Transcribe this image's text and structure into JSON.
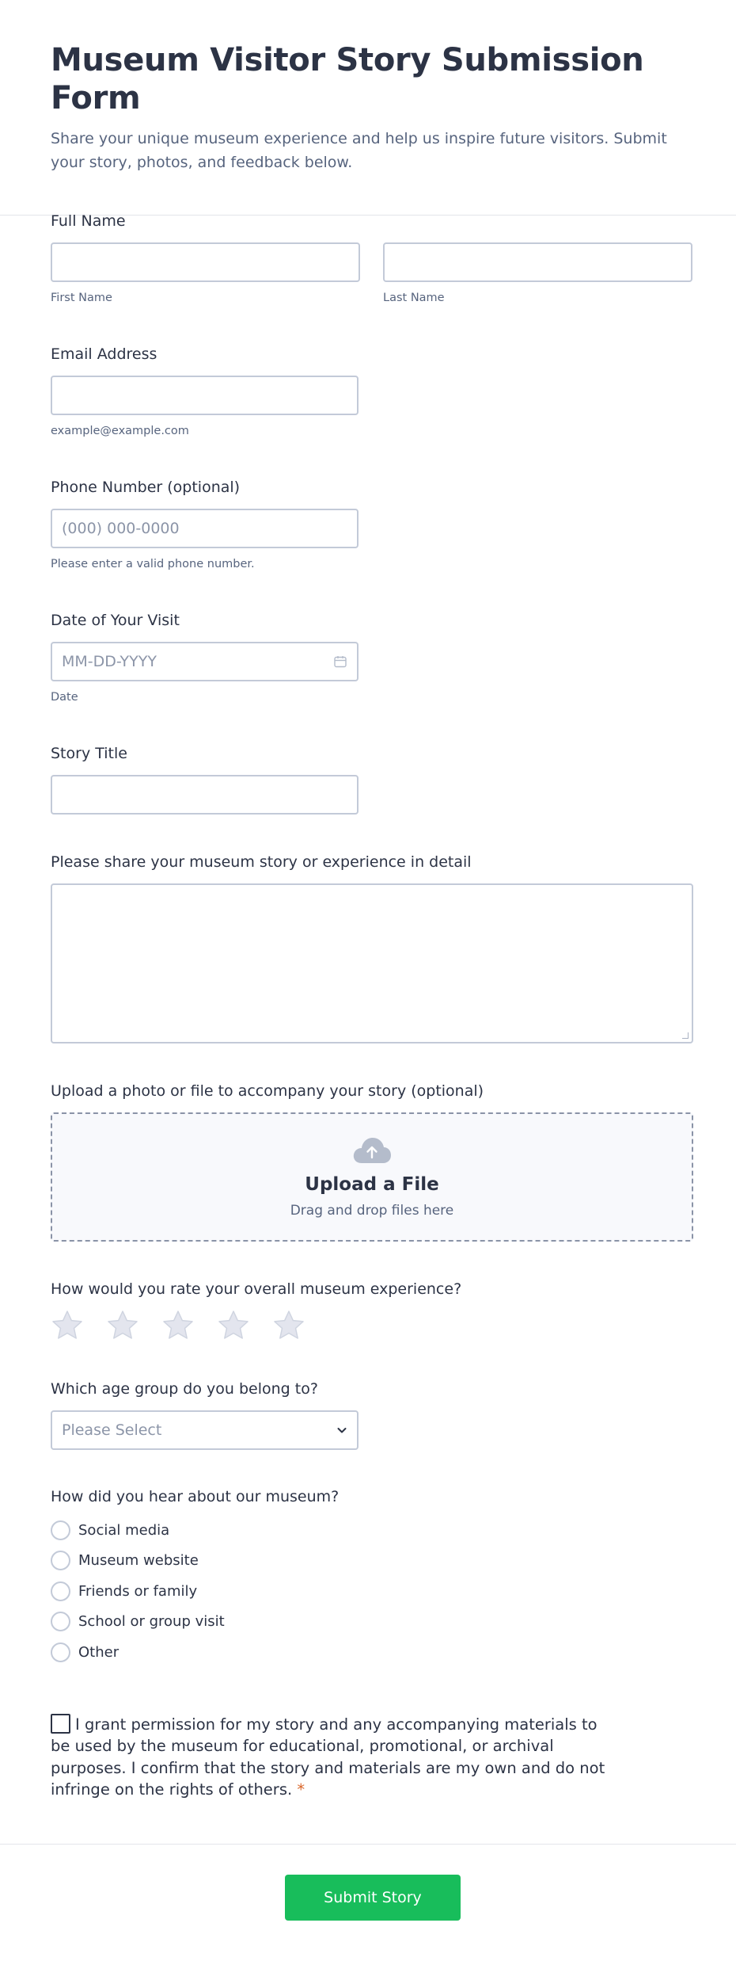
{
  "header": {
    "title": "Museum Visitor Story Submission Form",
    "description": "Share your unique museum experience and help us inspire future visitors. Submit your story, photos, and feedback below."
  },
  "full_name": {
    "label": "Full Name",
    "first_sublabel": "First Name",
    "last_sublabel": "Last Name",
    "first_value": "",
    "last_value": ""
  },
  "email": {
    "label": "Email Address",
    "sublabel": "example@example.com",
    "value": ""
  },
  "phone": {
    "label": "Phone Number (optional)",
    "placeholder": "(000) 000-0000",
    "sublabel": "Please enter a valid phone number."
  },
  "visit_date": {
    "label": "Date of Your Visit",
    "placeholder": "MM-DD-YYYY",
    "sublabel": "Date",
    "icon": "calendar-icon"
  },
  "story_title": {
    "label": "Story Title",
    "value": ""
  },
  "story": {
    "label": "Please share your museum story or experience in detail",
    "value": ""
  },
  "upload": {
    "label": "Upload a photo or file to accompany your story (optional)",
    "title": "Upload a File",
    "subtitle": "Drag and drop files here",
    "icon": "cloud-upload-icon"
  },
  "rating": {
    "label": "How would you rate your overall museum experience?",
    "max": 5,
    "value": 0,
    "icon": "star-icon"
  },
  "age_group": {
    "label": "Which age group do you belong to?",
    "selected": "Please Select",
    "icon": "chevron-down-icon"
  },
  "hear_about": {
    "label": "How did you hear about our museum?",
    "options": [
      "Social media",
      "Museum website",
      "Friends or family",
      "School or group visit",
      "Other"
    ]
  },
  "consent": {
    "text": "I grant permission for my story and any accompanying materials to be used by the museum for educational, promotional, or archival purposes. I confirm that the story and materials are my own and do not infringe on the rights of others.",
    "required_mark": "*",
    "checked": false
  },
  "submit": {
    "label": "Submit Story",
    "color": "#18bd5b"
  },
  "colors": {
    "text": "#2c3345",
    "muted": "#57647e",
    "border": "#c3cad8",
    "required": "#d9662a"
  }
}
